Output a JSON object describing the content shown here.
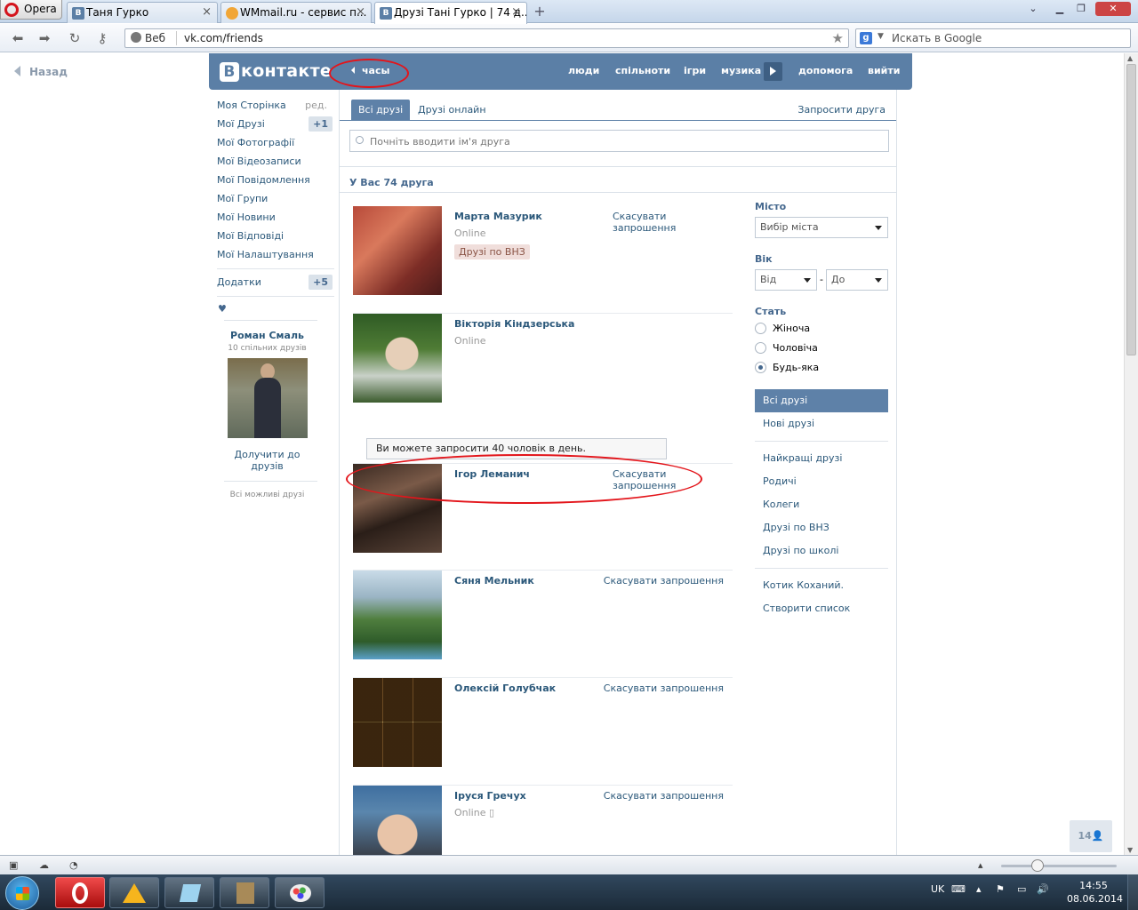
{
  "browser": {
    "menu_label": "Opera",
    "tabs": [
      {
        "title": "Таня Гурко",
        "icon": "vk-favicon"
      },
      {
        "title": "WMmail.ru - сервис п...",
        "icon": "wmmail-favicon"
      },
      {
        "title": "Друзі Тані Гурко | 74 д...",
        "icon": "vk-favicon"
      }
    ],
    "web_label": "Веб",
    "url": "vk.com/friends",
    "search_placeholder": "Искать в Google"
  },
  "page": {
    "back_label": "Назад",
    "header": {
      "logo": "контакте",
      "logo_letter": "В",
      "app_back": "часы",
      "nav": [
        "люди",
        "спільноти",
        "ігри",
        "музика",
        "допомога",
        "вийти"
      ]
    },
    "left_menu": {
      "items": [
        {
          "label": "Моя Сторінка",
          "extra": "ред."
        },
        {
          "label": "Мої Друзі",
          "badge": "+1"
        },
        {
          "label": "Мої Фотографії"
        },
        {
          "label": "Мої Відеозаписи"
        },
        {
          "label": "Мої Повідомлення"
        },
        {
          "label": "Мої Групи"
        },
        {
          "label": "Мої Новини"
        },
        {
          "label": "Мої Відповіді"
        },
        {
          "label": "Мої Налаштування"
        }
      ],
      "apps": {
        "label": "Додатки",
        "badge": "+5"
      },
      "heart": "♥"
    },
    "suggestion": {
      "name": "Роман Смаль",
      "common": "10 спільних друзів",
      "add": "Долучити до друзів",
      "all": "Всі можливі друзі"
    },
    "tabs": {
      "all": "Всі друзі",
      "online": "Друзі онлайн",
      "invite": "Запросити друга"
    },
    "search_placeholder": "Почніть вводити ім'я друга",
    "count_title": "У Вас 74 друга",
    "friends": [
      {
        "name": "Марта Мазурик",
        "status": "Online",
        "list": "Друзі по ВНЗ",
        "action": "Скасувати запрошення"
      },
      {
        "name": "Вікторія Кіндзерська",
        "status": "Online"
      },
      {
        "name": "Ігор Леманич",
        "action": "Скасувати запрошення"
      },
      {
        "name": "Сяня Мельник",
        "action": "Скасувати запрошення"
      },
      {
        "name": "Олексій Голубчак",
        "action": "Скасувати запрошення"
      },
      {
        "name": "Іруся Гречух",
        "status": "Online",
        "action": "Скасувати запрошення"
      }
    ],
    "invite_notice": "Ви можете запросити 40 чоловік в день.",
    "filters": {
      "city_title": "Місто",
      "city_select": "Вибір міста",
      "age_title": "Вік",
      "age_from": "Від",
      "age_to": "До",
      "age_dash": "-",
      "sex_title": "Стать",
      "sex_options": [
        "Жіноча",
        "Чоловіча",
        "Будь-яка"
      ],
      "sex_selected": 2
    },
    "filter_menu": {
      "group1": [
        "Всі друзі",
        "Нові друзі"
      ],
      "group2": [
        "Найкращі друзі",
        "Родичі",
        "Колеги",
        "Друзі по ВНЗ",
        "Друзі по школі"
      ],
      "group3": [
        "Котик Коханий.",
        "Створити список"
      ]
    },
    "online_counter": "14"
  },
  "taskbar": {
    "lang": "UK",
    "time": "14:55",
    "date": "08.06.2014"
  },
  "colors": {
    "vk_blue": "#5b7fa6",
    "link": "#2b587a",
    "annotation_red": "#e3151b"
  }
}
